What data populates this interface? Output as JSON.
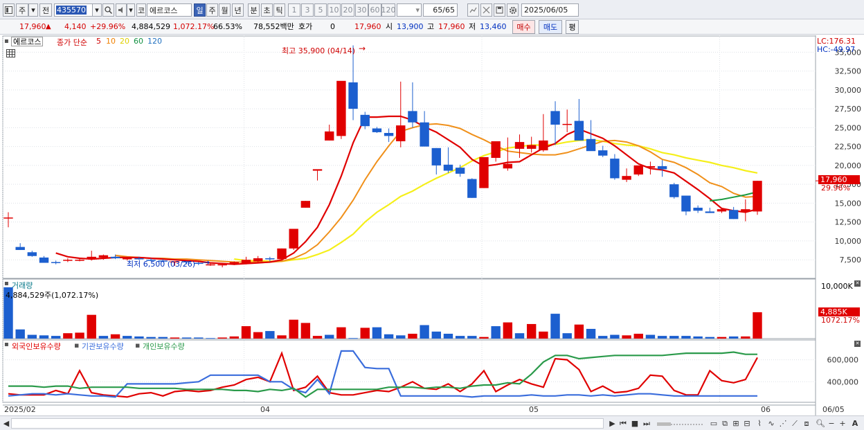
{
  "toolbar": {
    "market_btn": "주",
    "prev_btn": "전",
    "code": "435570",
    "market_label": "코",
    "name": "에르코스",
    "periods": [
      "일",
      "주",
      "월",
      "년",
      "분",
      "초",
      "틱"
    ],
    "active_period": "일",
    "minute_opts": [
      "1",
      "3",
      "5",
      "10",
      "20",
      "30",
      "60",
      "120"
    ],
    "count": "65/65",
    "date": "2025/06/05"
  },
  "info": {
    "price": "17,960",
    "change": "4,140",
    "change_pct": "+29.96%",
    "volume": "4,884,529",
    "volume_ratio": "1,072.17%",
    "turnover_rate": "66.53%",
    "amount": "78,552백만",
    "quote_label": "호가",
    "quote_val": "0",
    "quote_price": "17,960",
    "open_label": "시",
    "open": "13,900",
    "high_label": "고",
    "high": "17,960",
    "low_label": "저",
    "low": "13,460",
    "buy_btn": "매수",
    "sell_btn": "매도",
    "eval_btn": "평"
  },
  "chart_data": [
    {
      "type": "candlestick",
      "title_box": "에르코스",
      "legend": {
        "label": "종가 단순",
        "periods": [
          "5",
          "10",
          "20",
          "60",
          "120"
        ]
      },
      "lc": "LC:176.31",
      "hc": "HC:-49.97",
      "annotation_high": "최고 35,900 (04/14)",
      "annotation_low": "최저 6,500 (03/26)",
      "price_tag": "17,960",
      "pct_tag": "29.96%",
      "ylim": [
        5500,
        36500
      ],
      "yticks": [
        "35,000",
        "32,500",
        "30,000",
        "27,500",
        "25,000",
        "22,500",
        "20,000",
        "17,500",
        "15,000",
        "12,500",
        "10,000",
        "7,500"
      ],
      "ytick_values": [
        35000,
        32500,
        30000,
        27500,
        25000,
        22500,
        20000,
        17500,
        15000,
        12500,
        10000,
        7500
      ],
      "candles": [
        [
          13000,
          13800,
          11800,
          13100
        ],
        [
          9200,
          9700,
          8800,
          8800
        ],
        [
          8500,
          8700,
          7900,
          8000
        ],
        [
          7800,
          8000,
          7200,
          7100
        ],
        [
          7200,
          7400,
          6900,
          7100
        ],
        [
          7400,
          7700,
          7200,
          7500
        ],
        [
          7500,
          7700,
          7300,
          7500
        ],
        [
          7600,
          8700,
          7400,
          7900
        ],
        [
          7800,
          8200,
          7500,
          8100
        ],
        [
          7900,
          8200,
          7600,
          7700
        ],
        [
          7600,
          7900,
          7400,
          7700
        ],
        [
          7700,
          7900,
          7500,
          7600
        ],
        [
          7500,
          7700,
          7300,
          7400
        ],
        [
          7400,
          7600,
          7200,
          7300
        ],
        [
          7200,
          7300,
          6700,
          7300
        ],
        [
          7300,
          7300,
          6900,
          7200
        ],
        [
          7100,
          7200,
          6800,
          7000
        ],
        [
          6900,
          7100,
          6700,
          6900
        ],
        [
          6800,
          6900,
          6500,
          6900
        ],
        [
          6900,
          7300,
          6800,
          7200
        ],
        [
          7000,
          7900,
          6900,
          7500
        ],
        [
          7300,
          8000,
          7100,
          7700
        ],
        [
          7700,
          7900,
          7300,
          7600
        ],
        [
          7600,
          9000,
          7500,
          9000
        ],
        [
          9000,
          11600,
          8800,
          11600
        ],
        [
          14400,
          15300,
          14400,
          15300
        ],
        [
          19300,
          19300,
          18000,
          19500
        ],
        [
          23300,
          25400,
          23300,
          24500
        ],
        [
          23900,
          30800,
          23500,
          31200
        ],
        [
          31000,
          35900,
          26000,
          27500
        ],
        [
          26700,
          27100,
          24800,
          25200
        ],
        [
          24900,
          25100,
          24300,
          24400
        ],
        [
          24300,
          24900,
          23100,
          23900
        ],
        [
          23200,
          31100,
          22400,
          25300
        ],
        [
          27200,
          31000,
          25000,
          25700
        ],
        [
          25700,
          27200,
          22700,
          22500
        ],
        [
          22300,
          22300,
          18800,
          20000
        ],
        [
          20100,
          22400,
          19000,
          19300
        ],
        [
          19700,
          20100,
          18500,
          18900
        ],
        [
          18200,
          18300,
          15700,
          15700
        ],
        [
          17000,
          21000,
          17000,
          21100
        ],
        [
          21000,
          22600,
          20500,
          23200
        ],
        [
          19600,
          23700,
          19300,
          20200
        ],
        [
          22200,
          24100,
          21000,
          23100
        ],
        [
          22200,
          23800,
          21700,
          22700
        ],
        [
          22000,
          26800,
          21800,
          23300
        ],
        [
          27200,
          28500,
          22700,
          25400
        ],
        [
          25400,
          27400,
          24400,
          25500
        ],
        [
          25900,
          28800,
          23800,
          23300
        ],
        [
          23500,
          26000,
          22400,
          21900
        ],
        [
          22000,
          22600,
          21100,
          21300
        ],
        [
          20900,
          21500,
          18100,
          18300
        ],
        [
          18100,
          19600,
          17800,
          18600
        ],
        [
          18800,
          19800,
          18600,
          20000
        ],
        [
          19700,
          20500,
          18800,
          19900
        ],
        [
          19900,
          20700,
          18500,
          19500
        ],
        [
          17500,
          17700,
          15600,
          15800
        ],
        [
          16000,
          16000,
          13400,
          13900
        ],
        [
          14400,
          14700,
          13700,
          14000
        ],
        [
          13900,
          14400,
          13700,
          13700
        ],
        [
          13900,
          14400,
          13700,
          14200
        ],
        [
          14100,
          14500,
          12900,
          12900
        ],
        [
          13900,
          15500,
          12600,
          14200
        ],
        [
          13900,
          17960,
          13460,
          17960
        ]
      ],
      "ma5": [
        null,
        null,
        null,
        null,
        8400,
        7900,
        7700,
        7600,
        7700,
        7800,
        7800,
        7800,
        7700,
        7600,
        7500,
        7400,
        7300,
        7100,
        7000,
        6900,
        7000,
        7100,
        7200,
        7500,
        8400,
        9900,
        11800,
        14800,
        18600,
        23000,
        26400,
        26400,
        26500,
        26500,
        26000,
        25100,
        24400,
        23400,
        22400,
        20800,
        19900,
        20100,
        20400,
        20500,
        21400,
        22300,
        22900,
        24100,
        24800,
        24200,
        23600,
        22600,
        21400,
        20200,
        19600,
        19400,
        19000,
        17900,
        16800,
        15600,
        14300,
        14000,
        13800,
        14200
      ],
      "ma10": [
        null,
        null,
        null,
        null,
        null,
        null,
        null,
        null,
        null,
        8100,
        7900,
        7800,
        7700,
        7700,
        7600,
        7600,
        7500,
        7400,
        7300,
        7200,
        7200,
        7200,
        7200,
        7300,
        7700,
        8400,
        9500,
        11200,
        13100,
        15400,
        18100,
        20500,
        22600,
        24500,
        25000,
        25400,
        25500,
        25300,
        24900,
        24100,
        23400,
        22600,
        21900,
        21700,
        21500,
        21400,
        21400,
        21700,
        22200,
        22700,
        23200,
        23300,
        23100,
        22600,
        21800,
        20800,
        20400,
        19700,
        18800,
        17700,
        17200,
        16300,
        15800,
        15900
      ],
      "ma20": [
        null,
        null,
        null,
        null,
        null,
        null,
        null,
        null,
        null,
        null,
        null,
        null,
        null,
        null,
        null,
        null,
        null,
        null,
        null,
        7600,
        7400,
        7400,
        7300,
        7300,
        7500,
        7700,
        8200,
        8800,
        9800,
        10900,
        12500,
        13800,
        14800,
        15900,
        16600,
        17500,
        18300,
        19000,
        19700,
        20600,
        21300,
        21800,
        22300,
        22500,
        22700,
        22700,
        22800,
        23100,
        23300,
        23400,
        23200,
        22900,
        22700,
        22600,
        22200,
        21700,
        21400,
        21000,
        20700,
        20400,
        20000,
        19700,
        19300,
        19000
      ]
    },
    {
      "type": "bar",
      "title": "거래량",
      "caption": "4,884,529주(1,072.17%)",
      "ytick": "10,000K",
      "tag": "4,885K",
      "tag_pct": "1072.17%",
      "ylim": [
        0,
        10000
      ],
      "unit": "K",
      "values": [
        9500,
        1700,
        700,
        600,
        500,
        1000,
        1100,
        4400,
        500,
        800,
        500,
        400,
        300,
        300,
        200,
        200,
        200,
        100,
        200,
        400,
        2300,
        1200,
        1400,
        600,
        3500,
        2900,
        500,
        700,
        2100,
        100,
        2000,
        2100,
        800,
        600,
        900,
        2500,
        1300,
        900,
        500,
        500,
        300,
        2300,
        3000,
        1000,
        2700,
        1300,
        4600,
        1000,
        2600,
        1800,
        500,
        700,
        600,
        900,
        700,
        500,
        500,
        500,
        400,
        300,
        300,
        400,
        400,
        4885
      ],
      "up": [
        false,
        false,
        false,
        false,
        false,
        true,
        true,
        true,
        false,
        true,
        false,
        false,
        false,
        false,
        true,
        false,
        false,
        false,
        true,
        true,
        true,
        true,
        false,
        true,
        true,
        true,
        true,
        false,
        true,
        false,
        true,
        false,
        false,
        false,
        true,
        false,
        false,
        false,
        false,
        false,
        true,
        false,
        true,
        false,
        true,
        true,
        false,
        false,
        true,
        false,
        false,
        false,
        true,
        true,
        false,
        false,
        false,
        false,
        false,
        false,
        true,
        false,
        true,
        true
      ]
    },
    {
      "type": "line",
      "yticks": [
        "600,000",
        "400,000"
      ],
      "ytick_values": [
        600000,
        400000
      ],
      "ylim": [
        250000,
        730000
      ],
      "series": [
        {
          "name": "외국인보유수량",
          "color": "#e00000",
          "values": [
            290000,
            280000,
            280000,
            280000,
            320000,
            290000,
            500000,
            300000,
            280000,
            270000,
            260000,
            290000,
            300000,
            270000,
            310000,
            320000,
            310000,
            320000,
            350000,
            370000,
            420000,
            440000,
            400000,
            660000,
            320000,
            350000,
            450000,
            300000,
            280000,
            280000,
            300000,
            320000,
            310000,
            350000,
            400000,
            340000,
            330000,
            380000,
            310000,
            380000,
            500000,
            310000,
            370000,
            420000,
            380000,
            350000,
            610000,
            600000,
            510000,
            310000,
            360000,
            300000,
            310000,
            340000,
            460000,
            450000,
            320000,
            280000,
            280000,
            500000,
            410000,
            390000,
            420000,
            620000
          ]
        },
        {
          "name": "기관보유수량",
          "color": "#3a6ddc",
          "values": [
            270000,
            280000,
            290000,
            290000,
            280000,
            290000,
            280000,
            270000,
            270000,
            260000,
            380000,
            380000,
            380000,
            380000,
            380000,
            390000,
            400000,
            460000,
            460000,
            460000,
            460000,
            460000,
            400000,
            400000,
            330000,
            300000,
            420000,
            290000,
            680000,
            680000,
            530000,
            520000,
            520000,
            270000,
            270000,
            270000,
            270000,
            270000,
            270000,
            260000,
            270000,
            270000,
            270000,
            270000,
            280000,
            270000,
            270000,
            280000,
            280000,
            270000,
            280000,
            270000,
            280000,
            290000,
            290000,
            280000,
            270000,
            270000,
            270000,
            270000,
            270000,
            270000,
            270000,
            270000
          ]
        },
        {
          "name": "개인보유수량",
          "color": "#2a9a4a",
          "values": [
            360000,
            360000,
            360000,
            350000,
            360000,
            360000,
            340000,
            350000,
            350000,
            350000,
            350000,
            340000,
            340000,
            340000,
            340000,
            330000,
            330000,
            330000,
            330000,
            320000,
            320000,
            310000,
            330000,
            320000,
            340000,
            260000,
            330000,
            330000,
            330000,
            330000,
            330000,
            330000,
            350000,
            350000,
            350000,
            340000,
            350000,
            350000,
            340000,
            360000,
            370000,
            370000,
            390000,
            380000,
            470000,
            580000,
            640000,
            640000,
            610000,
            620000,
            630000,
            640000,
            640000,
            640000,
            640000,
            640000,
            650000,
            660000,
            660000,
            660000,
            660000,
            670000,
            650000,
            650000
          ]
        }
      ]
    }
  ],
  "xaxis": {
    "labels": [
      "2025/02",
      "04",
      "05",
      "06",
      "06/05"
    ]
  }
}
